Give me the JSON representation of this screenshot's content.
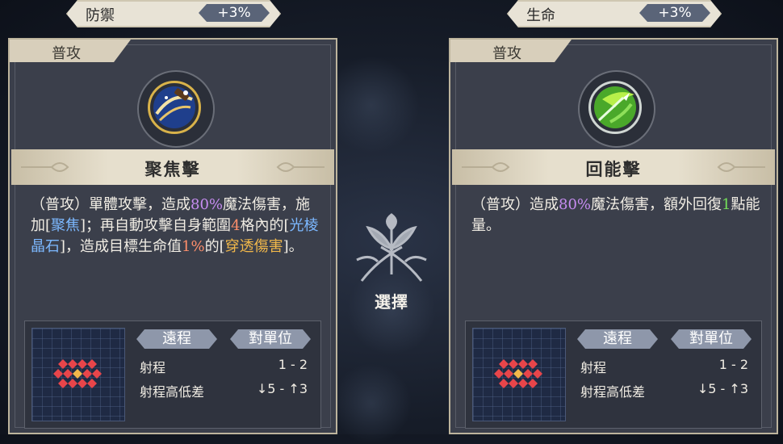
{
  "stats": [
    {
      "label": "防禦",
      "value": "+3%"
    },
    {
      "label": "生命",
      "value": "+3%"
    }
  ],
  "cards": [
    {
      "type_tab": "普攻",
      "icon": "focus-strike-icon",
      "name": "聚焦擊",
      "desc": [
        {
          "t": "（普攻）單體攻擊，造成",
          "c": ""
        },
        {
          "t": "80%",
          "c": "purple"
        },
        {
          "t": "魔法傷害，施加[",
          "c": ""
        },
        {
          "t": "聚焦",
          "c": "blue"
        },
        {
          "t": "]；再自動攻擊自身範圍",
          "c": ""
        },
        {
          "t": "4",
          "c": "red"
        },
        {
          "t": "格內的[",
          "c": ""
        },
        {
          "t": "光棱晶石",
          "c": "blue"
        },
        {
          "t": "]，造成目標生命值",
          "c": ""
        },
        {
          "t": "1%",
          "c": "red"
        },
        {
          "t": "的[",
          "c": ""
        },
        {
          "t": "穿透傷害",
          "c": "gold"
        },
        {
          "t": "]。",
          "c": ""
        }
      ],
      "tags": [
        "遠程",
        "對單位"
      ],
      "range_label": "射程",
      "range_value": "1 - 2",
      "height_label": "射程高低差",
      "height_value": "↓5 - ↑3"
    },
    {
      "type_tab": "普攻",
      "icon": "energy-strike-icon",
      "name": "回能擊",
      "desc": [
        {
          "t": "（普攻）造成",
          "c": ""
        },
        {
          "t": "80%",
          "c": "purple"
        },
        {
          "t": "魔法傷害，額外回復",
          "c": ""
        },
        {
          "t": "1",
          "c": "green"
        },
        {
          "t": "點能量。",
          "c": ""
        }
      ],
      "tags": [
        "遠程",
        "對單位"
      ],
      "range_label": "射程",
      "range_value": "1 - 2",
      "height_label": "射程高低差",
      "height_value": "↓5 - ↑3"
    }
  ],
  "select_label": "選擇",
  "colors": {
    "card_bg": "#3b3f4b",
    "band": "#e6dfcd",
    "purple": "#c68cf0",
    "blue": "#7cb8ff",
    "red": "#ff8f6b",
    "gold": "#f2b84a",
    "green": "#74e05a",
    "range_cells": "#e8454a"
  }
}
